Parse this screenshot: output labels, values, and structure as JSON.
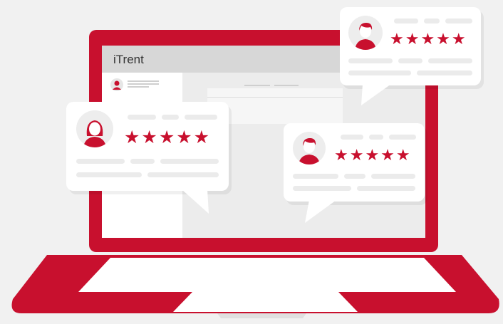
{
  "window": {
    "title": "iTrent"
  },
  "colors": {
    "accent": "#c8102e",
    "card": "#ffffff",
    "placeholder": "#ebebeb",
    "background": "#f1f1f1"
  },
  "reviews": [
    {
      "avatar_icon": "female-user-icon",
      "stars": "★★★★★",
      "rating": 5
    },
    {
      "avatar_icon": "male-user-icon",
      "stars": "★★★★★",
      "rating": 5
    },
    {
      "avatar_icon": "male-user-icon",
      "stars": "★★★★★",
      "rating": 5
    }
  ]
}
